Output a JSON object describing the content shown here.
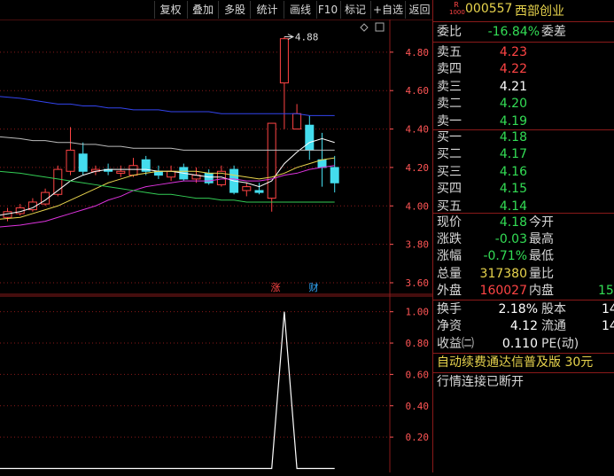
{
  "toolbar": {
    "buttons": [
      {
        "label": "复权"
      },
      {
        "label": "叠加"
      },
      {
        "label": "多股"
      },
      {
        "label": "统计"
      },
      {
        "label": "画线"
      },
      {
        "label": "F10"
      },
      {
        "label": "标记"
      },
      {
        "label": "+自选"
      },
      {
        "label": "返回"
      }
    ]
  },
  "stock": {
    "badge_top": "R",
    "badge_bottom": "1000",
    "code": "000557",
    "name": "西部创业"
  },
  "quote": {
    "weibi_label": "委比",
    "weibi_value": "-16.84%",
    "weicha_label": "委差",
    "sell": [
      {
        "label": "卖五",
        "price": "4.23"
      },
      {
        "label": "卖四",
        "price": "4.22"
      },
      {
        "label": "卖三",
        "price": "4.21"
      },
      {
        "label": "卖二",
        "price": "4.20"
      },
      {
        "label": "卖一",
        "price": "4.19"
      }
    ],
    "buy": [
      {
        "label": "买一",
        "price": "4.18"
      },
      {
        "label": "买二",
        "price": "4.17"
      },
      {
        "label": "买三",
        "price": "4.16"
      },
      {
        "label": "买四",
        "price": "4.15"
      },
      {
        "label": "买五",
        "price": "4.14"
      }
    ],
    "stats": [
      {
        "label": "现价",
        "value": "4.18",
        "label2": "今开"
      },
      {
        "label": "涨跌",
        "value": "-0.03",
        "label2": "最高"
      },
      {
        "label": "涨幅",
        "value": "-0.71%",
        "label2": "最低"
      },
      {
        "label": "总量",
        "value": "317380",
        "label2": "量比"
      },
      {
        "label": "外盘",
        "value": "160027",
        "label2": "内盘",
        "value2": "15"
      }
    ],
    "stats2": [
      {
        "label": "换手",
        "value": "2.18%",
        "label2": "股本",
        "value2": "14"
      },
      {
        "label": "净资",
        "value": "4.12",
        "label2": "流通",
        "value2": "14"
      },
      {
        "label": "收益㈡",
        "value": "0.110",
        "label2": "PE(动)"
      }
    ],
    "ad_text": "自动续费通达信普及版 30元",
    "status_text": "行情连接已断开"
  },
  "chart_data": [
    {
      "type": "candlestick",
      "price_labels": [
        "4.80",
        "4.60",
        "4.40",
        "4.20",
        "4.00",
        "3.80",
        "3.60"
      ],
      "price_ticks": [
        4.8,
        4.6,
        4.4,
        4.2,
        4.0,
        3.8,
        3.6
      ],
      "ylim": [
        3.54,
        4.97
      ],
      "high_annotation": "4.88",
      "high_value": 4.88,
      "markers": [
        {
          "label": "涨",
          "color": "#ff4444"
        },
        {
          "label": "财",
          "color": "#33aaff"
        }
      ],
      "candles": [
        {
          "o": 3.94,
          "c": 3.97,
          "h": 3.99,
          "l": 3.92
        },
        {
          "o": 3.96,
          "c": 3.99,
          "h": 4.01,
          "l": 3.95
        },
        {
          "o": 3.98,
          "c": 4.02,
          "h": 4.04,
          "l": 3.97
        },
        {
          "o": 4.01,
          "c": 4.07,
          "h": 4.09,
          "l": 4.0
        },
        {
          "o": 4.06,
          "c": 4.19,
          "h": 4.21,
          "l": 4.05
        },
        {
          "o": 4.18,
          "c": 4.29,
          "h": 4.41,
          "l": 4.16
        },
        {
          "o": 4.27,
          "c": 4.18,
          "h": 4.33,
          "l": 4.16
        },
        {
          "o": 4.18,
          "c": 4.19,
          "h": 4.21,
          "l": 4.16
        },
        {
          "o": 4.19,
          "c": 4.18,
          "h": 4.22,
          "l": 4.16
        },
        {
          "o": 4.17,
          "c": 4.18,
          "h": 4.21,
          "l": 4.15
        },
        {
          "o": 4.16,
          "c": 4.21,
          "h": 4.25,
          "l": 4.15
        },
        {
          "o": 4.24,
          "c": 4.18,
          "h": 4.26,
          "l": 4.16
        },
        {
          "o": 4.18,
          "c": 4.16,
          "h": 4.21,
          "l": 4.14
        },
        {
          "o": 4.15,
          "c": 4.18,
          "h": 4.21,
          "l": 4.13
        },
        {
          "o": 4.2,
          "c": 4.14,
          "h": 4.22,
          "l": 4.13
        },
        {
          "o": 4.14,
          "c": 4.16,
          "h": 4.2,
          "l": 4.12
        },
        {
          "o": 4.17,
          "c": 4.12,
          "h": 4.19,
          "l": 4.11
        },
        {
          "o": 4.11,
          "c": 4.18,
          "h": 4.21,
          "l": 4.1
        },
        {
          "o": 4.19,
          "c": 4.07,
          "h": 4.21,
          "l": 4.06
        },
        {
          "o": 4.08,
          "c": 4.1,
          "h": 4.12,
          "l": 4.05
        },
        {
          "o": 4.08,
          "c": 4.07,
          "h": 4.12,
          "l": 4.06
        },
        {
          "o": 4.04,
          "c": 4.43,
          "h": 4.43,
          "l": 3.97
        },
        {
          "o": 4.64,
          "c": 4.87,
          "h": 4.88,
          "l": 4.4
        },
        {
          "o": 4.4,
          "c": 4.48,
          "h": 4.53,
          "l": 4.4
        },
        {
          "o": 4.42,
          "c": 4.29,
          "h": 4.47,
          "l": 4.24
        },
        {
          "o": 4.24,
          "c": 4.2,
          "h": 4.38,
          "l": 4.1
        },
        {
          "o": 4.2,
          "c": 4.12,
          "h": 4.26,
          "l": 4.07
        }
      ],
      "ma_lines": [
        {
          "color": "#ffffff",
          "values": [
            3.95,
            3.97,
            3.99,
            4.03,
            4.08,
            4.13,
            4.16,
            4.18,
            4.19,
            4.19,
            4.19,
            4.19,
            4.18,
            4.18,
            4.17,
            4.16,
            4.15,
            4.15,
            4.13,
            4.12,
            4.1,
            4.13,
            4.22,
            4.28,
            4.33,
            4.35,
            4.33
          ]
        },
        {
          "color": "#e8d44d",
          "values": [
            3.93,
            3.94,
            3.96,
            3.98,
            4.0,
            4.03,
            4.06,
            4.09,
            4.12,
            4.14,
            4.16,
            4.17,
            4.18,
            4.18,
            4.18,
            4.18,
            4.17,
            4.17,
            4.16,
            4.15,
            4.14,
            4.15,
            4.17,
            4.2,
            4.22,
            4.24,
            4.25
          ]
        },
        {
          "color": "#dd33dd",
          "values": [
            3.89,
            3.9,
            3.91,
            3.92,
            3.94,
            3.96,
            3.98,
            4.0,
            4.03,
            4.05,
            4.08,
            4.1,
            4.11,
            4.12,
            4.13,
            4.13,
            4.13,
            4.14,
            4.14,
            4.13,
            4.13,
            4.14,
            4.16,
            4.17,
            4.19,
            4.2,
            4.21
          ]
        },
        {
          "color": "#33cc55",
          "values": [
            4.18,
            4.17,
            4.16,
            4.15,
            4.14,
            4.13,
            4.12,
            4.11,
            4.1,
            4.09,
            4.08,
            4.07,
            4.06,
            4.06,
            4.05,
            4.04,
            4.04,
            4.03,
            4.03,
            4.02,
            4.02,
            4.02,
            4.02,
            4.02,
            4.02,
            4.02,
            4.02
          ]
        },
        {
          "color": "#bbbbbb",
          "values": [
            4.36,
            4.35,
            4.34,
            4.34,
            4.33,
            4.33,
            4.32,
            4.32,
            4.31,
            4.31,
            4.3,
            4.3,
            4.3,
            4.3,
            4.29,
            4.29,
            4.29,
            4.29,
            4.29,
            4.29,
            4.29,
            4.29,
            4.29,
            4.29,
            4.29,
            4.29,
            4.29
          ]
        },
        {
          "color": "#3344ee",
          "values": [
            4.57,
            4.56,
            4.55,
            4.54,
            4.53,
            4.53,
            4.52,
            4.52,
            4.51,
            4.51,
            4.5,
            4.5,
            4.5,
            4.49,
            4.49,
            4.49,
            4.49,
            4.48,
            4.48,
            4.48,
            4.48,
            4.48,
            4.48,
            4.48,
            4.47,
            4.47,
            4.47
          ]
        }
      ]
    },
    {
      "type": "line",
      "y_labels": [
        "1.00",
        "0.80",
        "0.60",
        "0.40",
        "0.20"
      ],
      "y_ticks": [
        1.0,
        0.8,
        0.6,
        0.4,
        0.2
      ],
      "ylim": [
        -0.02,
        1.1
      ],
      "values": [
        0,
        0,
        0,
        0,
        0,
        0,
        0,
        0,
        0,
        0,
        0,
        0,
        0,
        0,
        0,
        0,
        0,
        0,
        0,
        0,
        0,
        0,
        1,
        0,
        0,
        0,
        0
      ]
    }
  ]
}
